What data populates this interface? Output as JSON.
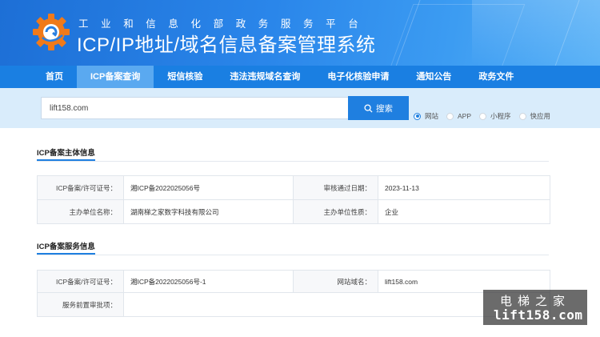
{
  "header": {
    "subtitle": "工业和信息化部政务服务平台",
    "title": "ICP/IP地址/域名信息备案管理系统"
  },
  "nav": {
    "items": [
      {
        "label": "首页",
        "active": false
      },
      {
        "label": "ICP备案查询",
        "active": true
      },
      {
        "label": "短信核验",
        "active": false
      },
      {
        "label": "违法违规域名查询",
        "active": false
      },
      {
        "label": "电子化核验申请",
        "active": false
      },
      {
        "label": "通知公告",
        "active": false
      },
      {
        "label": "政务文件",
        "active": false
      }
    ]
  },
  "search": {
    "value": "lift158.com",
    "button_label": "搜索",
    "options": [
      {
        "label": "网站",
        "checked": true
      },
      {
        "label": "APP",
        "checked": false
      },
      {
        "label": "小程序",
        "checked": false
      },
      {
        "label": "快应用",
        "checked": false
      }
    ]
  },
  "subject": {
    "section_title": "ICP备案主体信息",
    "license_label": "ICP备案/许可证号：",
    "license_value": "湘ICP备2022025056号",
    "approve_date_label": "审核通过日期：",
    "approve_date_value": "2023-11-13",
    "org_name_label": "主办单位名称：",
    "org_name_value": "湖南梯之家数字科技有限公司",
    "org_type_label": "主办单位性质：",
    "org_type_value": "企业"
  },
  "service": {
    "section_title": "ICP备案服务信息",
    "license_label": "ICP备案/许可证号：",
    "license_value": "湘ICP备2022025056号-1",
    "domain_label": "网站域名：",
    "domain_value": "lift158.com",
    "preapproval_label": "服务前置审批项：",
    "preapproval_value": ""
  },
  "watermark": {
    "cn": "电梯之家",
    "en": "lift158.com"
  },
  "colors": {
    "primary": "#1f7fe0",
    "nav_bg": "#1a7fe2",
    "nav_active": "#5aa9f0",
    "search_band": "#d9ecfb"
  }
}
